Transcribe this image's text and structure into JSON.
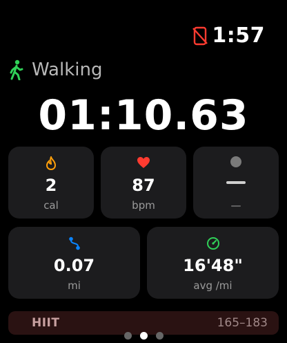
{
  "status": {
    "time": "1:57",
    "icons": [
      "phone-disconnected-icon"
    ]
  },
  "activity": {
    "icon": "walking-figure-icon",
    "label": "Walking"
  },
  "elapsed": "01:10.63",
  "metrics": [
    {
      "icon": "flame-icon",
      "value": "2",
      "unit": "cal",
      "color": "#ff9f0a"
    },
    {
      "icon": "heart-icon",
      "value": "87",
      "unit": "bpm",
      "color": "#ff3b30"
    },
    {
      "icon": "dot-icon",
      "value": "",
      "unit": "—",
      "color": "#7a7a7a"
    },
    {
      "icon": "route-icon",
      "value": "0.07",
      "unit": "mi",
      "color": "#0a84ff"
    },
    {
      "icon": "pace-gauge-icon",
      "value": "16'48\"",
      "unit": "avg /mi",
      "color": "#30d158"
    }
  ],
  "zone": {
    "name": "HIIT",
    "range": "165–183"
  },
  "pager": {
    "count": 3,
    "active": 1
  },
  "colors": {
    "background": "#000000",
    "tile": "#1c1c1e",
    "accent_green": "#30d158",
    "alert_red": "#ff3b30"
  }
}
